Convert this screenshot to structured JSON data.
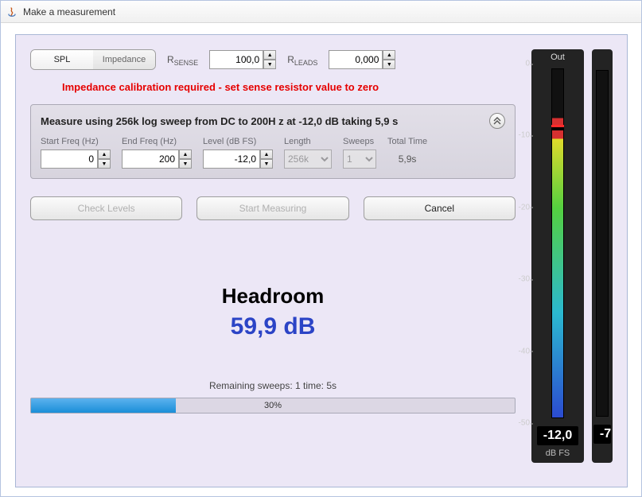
{
  "window": {
    "title": "Make a measurement"
  },
  "segmented": {
    "spl": "SPL",
    "impedance": "Impedance"
  },
  "rsense": {
    "label": "R",
    "sub": "SENSE",
    "value": "100,0"
  },
  "rleads": {
    "label": "R",
    "sub": "LEADS",
    "value": "0,000"
  },
  "warning": "Impedance calibration required - set sense resistor value to zero",
  "measure": {
    "summary": "Measure using  256k log sweep from DC to 200H z at -12,0 dB taking 5,9 s",
    "startFreq": {
      "label": "Start Freq (Hz)",
      "value": "0"
    },
    "endFreq": {
      "label": "End Freq (Hz)",
      "value": "200"
    },
    "level": {
      "label": "Level (dB FS)",
      "value": "-12,0"
    },
    "length": {
      "label": "Length",
      "value": "256k"
    },
    "sweeps": {
      "label": "Sweeps",
      "value": "1"
    },
    "totalTime": {
      "label": "Total Time",
      "value": "5,9s"
    }
  },
  "buttons": {
    "checkLevels": "Check Levels",
    "startMeasuring": "Start Measuring",
    "cancel": "Cancel"
  },
  "headroom": {
    "title": "Headroom",
    "value": "59,9 dB"
  },
  "status": "Remaining sweeps: 1   time: 5s",
  "progress": {
    "percent": 30,
    "label": "30%"
  },
  "meters": {
    "out": {
      "title": "Out",
      "readout": "-12,0",
      "unit": "dB FS",
      "ticks": [
        0,
        -10,
        -20,
        -30,
        -40,
        -50
      ]
    },
    "in": {
      "readout": "-7"
    }
  }
}
